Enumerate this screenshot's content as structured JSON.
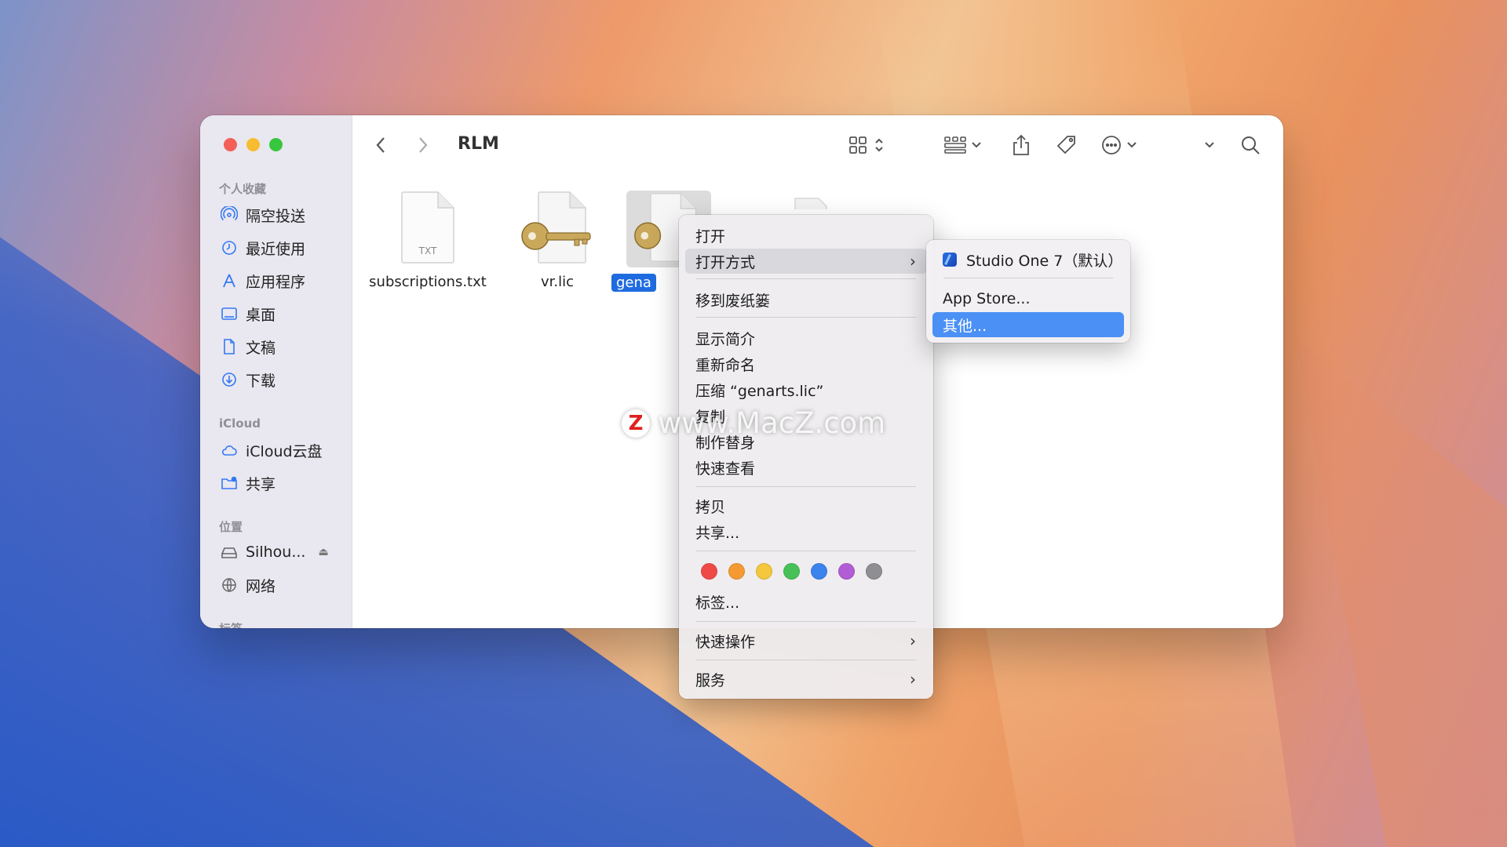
{
  "window": {
    "title": "RLM"
  },
  "sidebar": {
    "favorites_header": "个人收藏",
    "favorites": [
      {
        "label": "隔空投送",
        "icon": "airdrop-icon"
      },
      {
        "label": "最近使用",
        "icon": "clock-icon"
      },
      {
        "label": "应用程序",
        "icon": "applications-icon"
      },
      {
        "label": "桌面",
        "icon": "desktop-icon"
      },
      {
        "label": "文稿",
        "icon": "document-icon"
      },
      {
        "label": "下载",
        "icon": "download-icon"
      }
    ],
    "icloud_header": "iCloud",
    "icloud": [
      {
        "label": "iCloud云盘",
        "icon": "cloud-icon"
      },
      {
        "label": "共享",
        "icon": "shared-folder-icon"
      }
    ],
    "locations_header": "位置",
    "locations": [
      {
        "label": "Silhou...",
        "icon": "drive-icon"
      },
      {
        "label": "网络",
        "icon": "globe-icon"
      }
    ],
    "tags_header_partial": "标签"
  },
  "files": [
    {
      "name": "subscriptions.txt",
      "icon_label": "TXT",
      "type": "text"
    },
    {
      "name": "vr.lic",
      "type": "license"
    },
    {
      "name": "gena",
      "type": "license",
      "selected": true
    }
  ],
  "context_menu": {
    "items": [
      {
        "label": "打开"
      },
      {
        "label": "打开方式",
        "submenu": true
      },
      {
        "label": "移到废纸篓"
      },
      {
        "label": "显示简介"
      },
      {
        "label": "重新命名"
      },
      {
        "label": "压缩 “genarts.lic”"
      },
      {
        "label": "复制"
      },
      {
        "label": "制作替身"
      },
      {
        "label": "快速查看"
      },
      {
        "label": "拷贝"
      },
      {
        "label": "共享..."
      },
      {
        "label": "标签..."
      },
      {
        "label": "快速操作",
        "submenu": true
      },
      {
        "label": "服务",
        "submenu": true
      }
    ],
    "tag_colors": [
      "#ef4b46",
      "#f59a32",
      "#f4c73c",
      "#47c157",
      "#3b84ee",
      "#b25cd6",
      "#8e8e93"
    ]
  },
  "submenu": {
    "items": [
      {
        "label": "Studio One 7（默认）",
        "icon": "studio-one-icon"
      },
      {
        "label": "App Store..."
      },
      {
        "label": "其他...",
        "selected": true
      }
    ]
  },
  "watermark": {
    "logo": "Z",
    "text": "www.MacZ.com"
  }
}
